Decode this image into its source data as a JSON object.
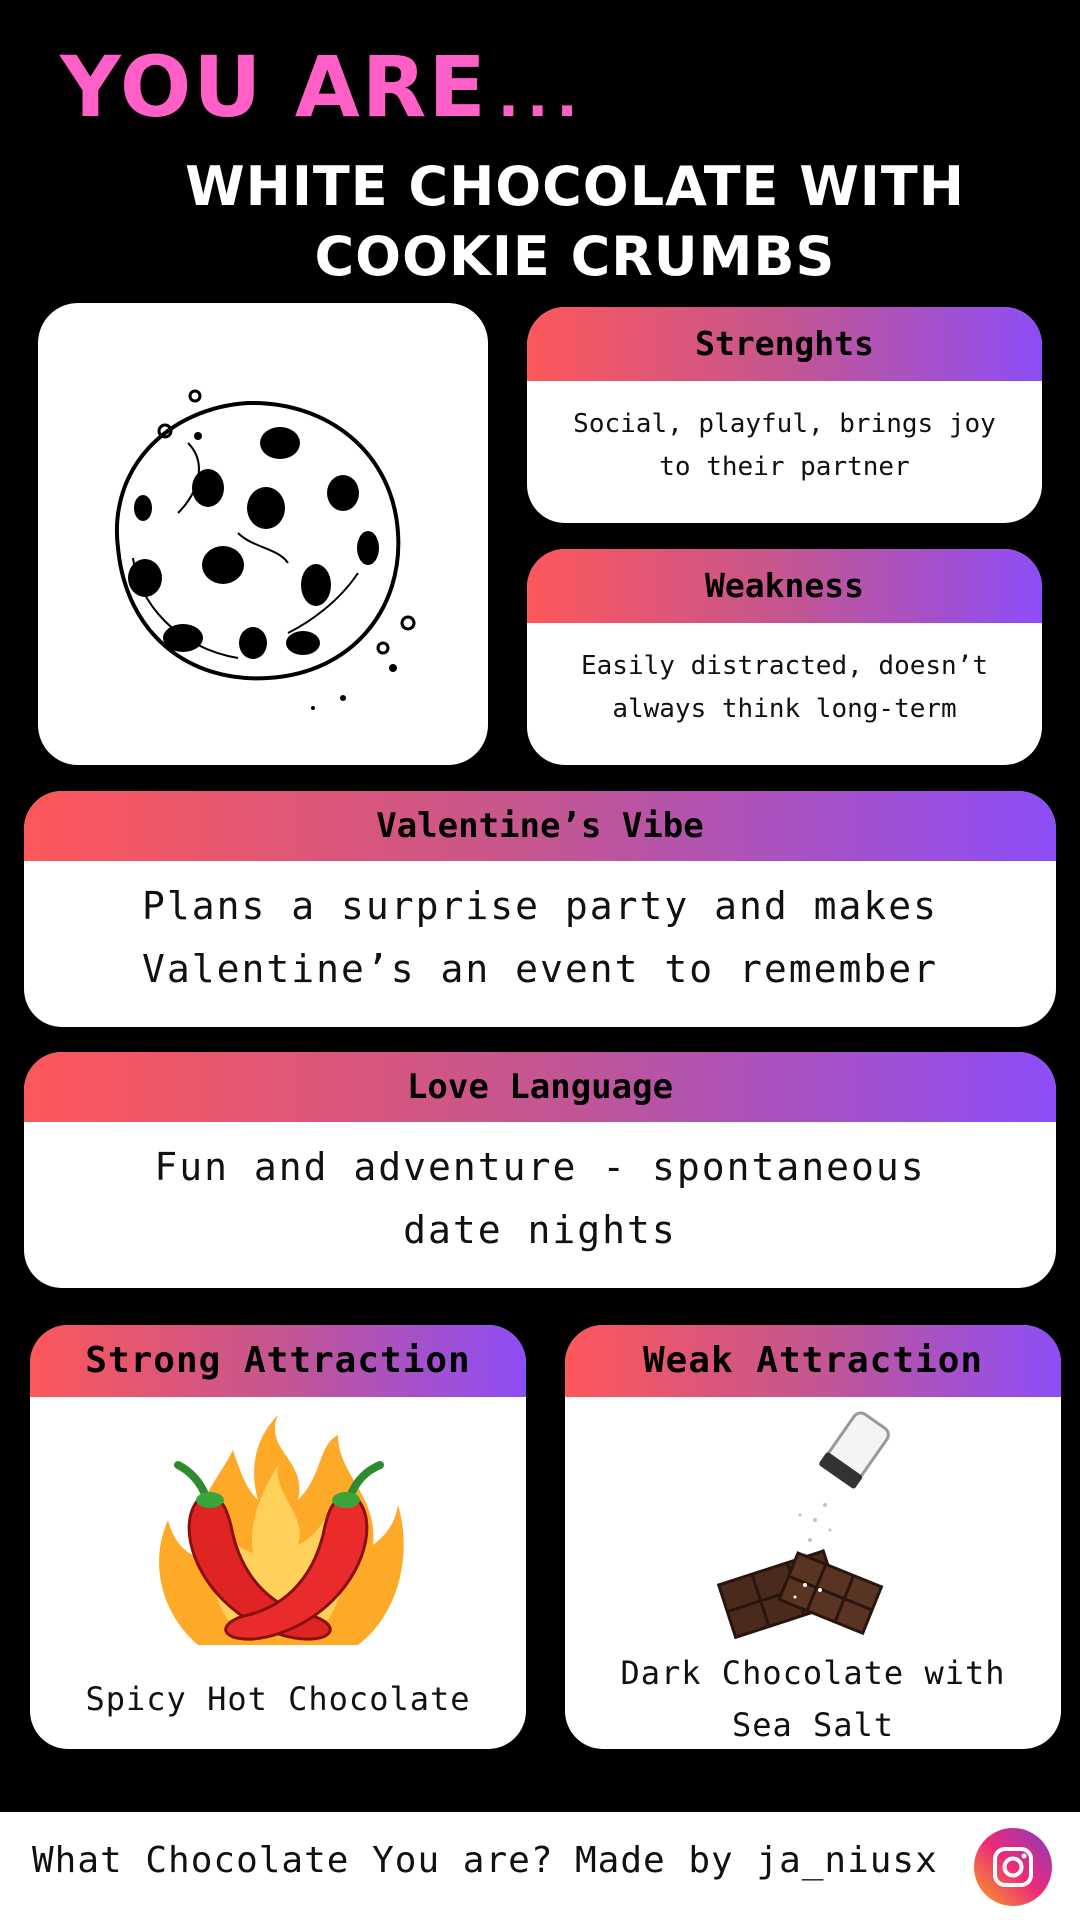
{
  "header": {
    "title": "YOU ARE",
    "title_dots": "...",
    "subtitle_line1": "WHITE CHOCOLATE WITH",
    "subtitle_line2": "COOKIE CRUMBS"
  },
  "colors": {
    "title_pink": "#ff5fc6",
    "gradient_start": "#fd575a",
    "gradient_end": "#8d4df7",
    "background": "#000000"
  },
  "cards": {
    "strengths": {
      "title": "Strenghts",
      "line1": "Social, playful, brings joy",
      "line2": "to their partner"
    },
    "weakness": {
      "title": "Weakness",
      "line1": "Easily distracted, doesn’t",
      "line2": "always think long-term"
    },
    "valentine": {
      "title": "Valentine’s Vibe",
      "line1": "Plans a surprise party and makes",
      "line2": "Valentine’s an event to remember"
    },
    "love_language": {
      "title": "Love Language",
      "line1": "Fun and adventure - spontaneous",
      "line2": "date nights"
    }
  },
  "attractions": {
    "strong": {
      "title": "Strong Attraction",
      "caption": "Spicy Hot Chocolate",
      "icon": "chili-flame-icon"
    },
    "weak": {
      "title": "Weak Attraction",
      "caption_line1": "Dark Chocolate with",
      "caption_line2": "Sea Salt",
      "icon": "chocolate-salt-icon"
    }
  },
  "cookie_icon": "cookie-icon",
  "footer": {
    "left_text": "What Chocolate You are?",
    "right_text": "Made by ja_niusx",
    "social_icon": "instagram-icon"
  }
}
